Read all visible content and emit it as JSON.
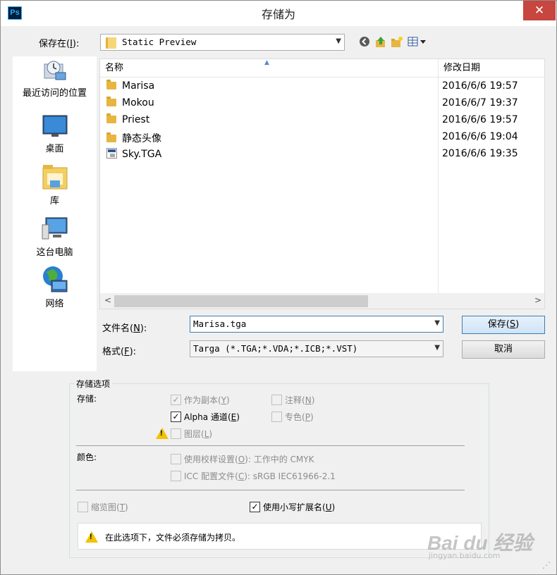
{
  "window": {
    "app_icon": "Ps",
    "title": "存储为",
    "close_icon": "✕"
  },
  "save_in": {
    "label_prefix": "保存在(",
    "label_key": "I",
    "label_suffix": "):",
    "value": "Static Preview"
  },
  "toolbar": {
    "icons": [
      "back-icon",
      "up-folder-icon",
      "new-folder-icon",
      "view-menu-icon"
    ]
  },
  "places": [
    {
      "label": "最近访问的位置",
      "icon": "recent-places-icon"
    },
    {
      "label": "桌面",
      "icon": "desktop-icon"
    },
    {
      "label": "库",
      "icon": "libraries-icon"
    },
    {
      "label": "这台电脑",
      "icon": "this-pc-icon"
    },
    {
      "label": "网络",
      "icon": "network-icon"
    }
  ],
  "file_list": {
    "col_name": "名称",
    "col_date": "修改日期",
    "rows": [
      {
        "name": "Marisa",
        "date": "2016/6/6 19:57",
        "type": "folder"
      },
      {
        "name": "Mokou",
        "date": "2016/6/7 19:37",
        "type": "folder"
      },
      {
        "name": "Priest",
        "date": "2016/6/6 19:57",
        "type": "folder"
      },
      {
        "name": "静态头像",
        "date": "2016/6/6 19:04",
        "type": "folder"
      },
      {
        "name": "Sky.TGA",
        "date": "2016/6/6 19:35",
        "type": "file"
      }
    ]
  },
  "filename": {
    "label_prefix": "文件名(",
    "label_key": "N",
    "label_suffix": "):",
    "value": "Marisa.tga"
  },
  "format": {
    "label_prefix": "格式(",
    "label_key": "F",
    "label_suffix": "):",
    "value": "Targa (*.TGA;*.VDA;*.ICB;*.VST)"
  },
  "buttons": {
    "save_prefix": "保存(",
    "save_key": "S",
    "save_suffix": ")",
    "cancel": "取消"
  },
  "options": {
    "legend": "存储选项",
    "storage_label": "存储:",
    "as_copy": {
      "label": "作为副本",
      "key": "Y",
      "checked": true,
      "enabled": false
    },
    "alpha": {
      "label": "Alpha 通道",
      "key": "E",
      "checked": true,
      "enabled": true
    },
    "layers": {
      "label": "图层",
      "key": "L",
      "checked": false,
      "enabled": false
    },
    "notes": {
      "label": "注释",
      "key": "N",
      "checked": false,
      "enabled": false
    },
    "spot": {
      "label": "专色",
      "key": "P",
      "checked": false,
      "enabled": false
    },
    "color_label": "颜色:",
    "proof": {
      "label": "使用校样设置",
      "key": "O",
      "value": "工作中的 CMYK",
      "checked": false,
      "enabled": false
    },
    "icc": {
      "label": "ICC 配置文件",
      "key": "C",
      "value": "sRGB IEC61966-2.1",
      "checked": false,
      "enabled": false
    },
    "thumbnail": {
      "label": "缩览图",
      "key": "T",
      "checked": false,
      "enabled": false
    },
    "lowercase_ext": {
      "label": "使用小写扩展名",
      "key": "U",
      "checked": true,
      "enabled": true
    },
    "notice": "在此选项下，文件必须存储为拷贝。"
  },
  "watermark": {
    "brand": "Bai du 经验",
    "url": "jingyan.baidu.com"
  },
  "colors": {
    "close_red": "#c7463f",
    "folder_yellow": "#e7b541",
    "warning_yellow": "#f2c200"
  }
}
